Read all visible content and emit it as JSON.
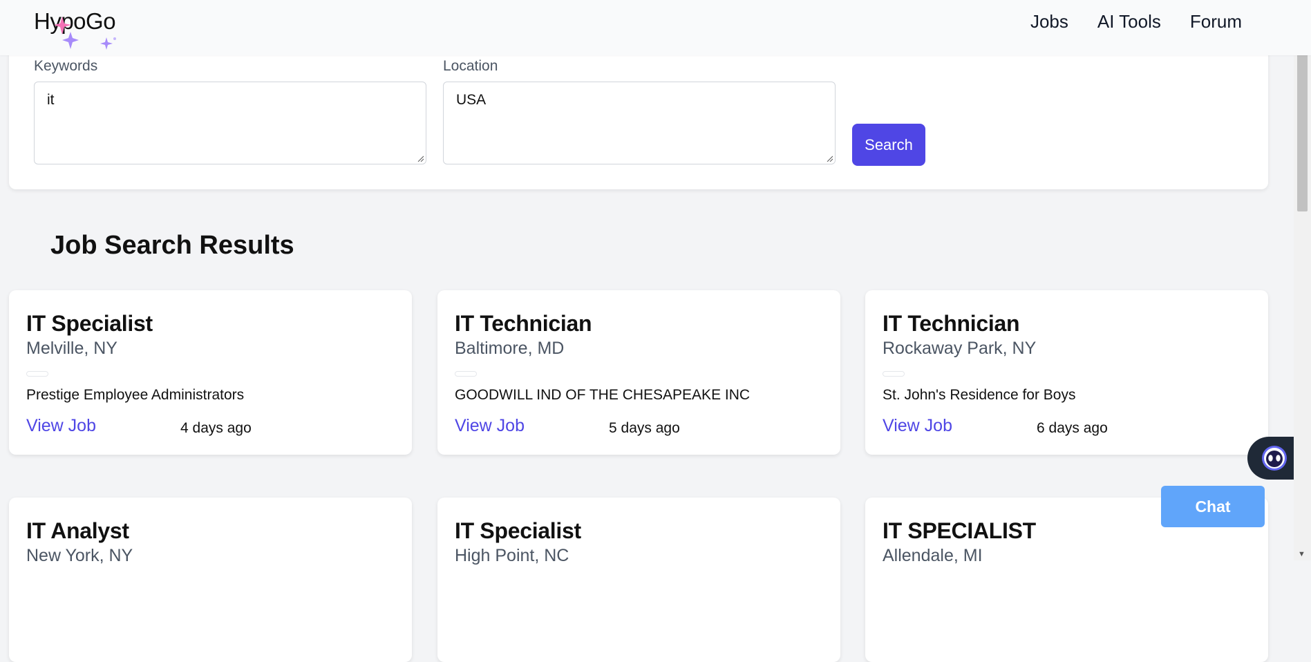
{
  "header": {
    "logo": "HypoGo",
    "nav": [
      "Jobs",
      "AI Tools",
      "Forum"
    ]
  },
  "search": {
    "keywords_label": "Keywords",
    "keywords_value": "it",
    "location_label": "Location",
    "location_value": "USA",
    "button_label": "Search"
  },
  "results": {
    "title": "Job Search Results",
    "jobs": [
      {
        "title": "IT Specialist",
        "location": "Melville, NY",
        "company": "Prestige Employee Administrators",
        "link": "View Job",
        "posted": "4 days ago"
      },
      {
        "title": "IT Technician",
        "location": "Baltimore, MD",
        "company": "GOODWILL IND OF THE CHESAPEAKE INC",
        "link": "View Job",
        "posted": "5 days ago"
      },
      {
        "title": "IT Technician",
        "location": "Rockaway Park, NY",
        "company": "St. John's Residence for Boys",
        "link": "View Job",
        "posted": "6 days ago"
      },
      {
        "title": "IT Analyst",
        "location": "New York, NY"
      },
      {
        "title": "IT Specialist",
        "location": "High Point, NC"
      },
      {
        "title": "IT SPECIALIST",
        "location": "Allendale, MI"
      }
    ]
  },
  "chat": {
    "button_label": "Chat"
  },
  "colors": {
    "accent": "#4f46e5",
    "chat_button": "#60a5fa",
    "bot_bg": "#1f2937"
  }
}
